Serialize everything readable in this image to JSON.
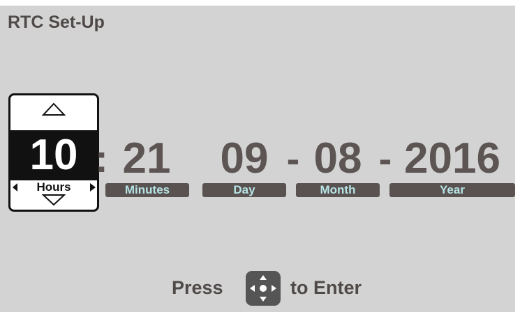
{
  "screen": {
    "title": "RTC Set-Up"
  },
  "fields": {
    "hours": {
      "value": "10",
      "label": "Hours"
    },
    "minutes": {
      "value": "21",
      "label": "Minutes"
    },
    "day": {
      "value": "09",
      "label": "Day"
    },
    "month": {
      "value": "08",
      "label": "Month"
    },
    "year": {
      "value": "2016",
      "label": "Year"
    }
  },
  "separators": {
    "time": ":",
    "date": "-"
  },
  "footer": {
    "press": "Press",
    "enter": "to Enter",
    "icon": "dpad-icon"
  },
  "colors": {
    "background": "#d3d3d3",
    "text": "#5c5553",
    "label_bg": "#5a5250",
    "label_text": "#b7e4e6",
    "selected_bg": "#111111"
  }
}
